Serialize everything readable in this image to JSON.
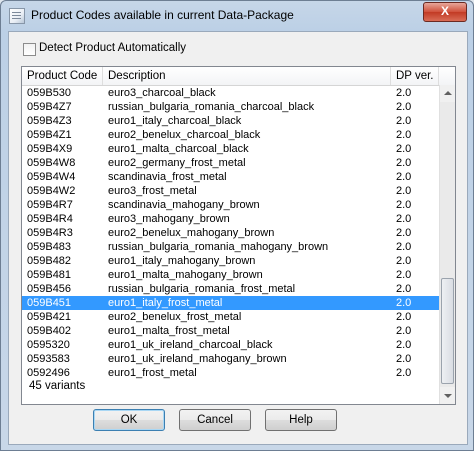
{
  "window": {
    "title": "Product Codes available in current Data-Package",
    "close_label": "X"
  },
  "detect": {
    "label": "Detect Product Automatically",
    "checked": false
  },
  "table": {
    "headers": {
      "code": "Product Code",
      "description": "Description",
      "version": "DP ver."
    },
    "rows": [
      {
        "code": "059B530",
        "description": "euro3_charcoal_black",
        "version": "2.0"
      },
      {
        "code": "059B4Z7",
        "description": "russian_bulgaria_romania_charcoal_black",
        "version": "2.0"
      },
      {
        "code": "059B4Z3",
        "description": "euro1_italy_charcoal_black",
        "version": "2.0"
      },
      {
        "code": "059B4Z1",
        "description": "euro2_benelux_charcoal_black",
        "version": "2.0"
      },
      {
        "code": "059B4X9",
        "description": "euro1_malta_charcoal_black",
        "version": "2.0"
      },
      {
        "code": "059B4W8",
        "description": "euro2_germany_frost_metal",
        "version": "2.0"
      },
      {
        "code": "059B4W4",
        "description": "scandinavia_frost_metal",
        "version": "2.0"
      },
      {
        "code": "059B4W2",
        "description": "euro3_frost_metal",
        "version": "2.0"
      },
      {
        "code": "059B4R7",
        "description": "scandinavia_mahogany_brown",
        "version": "2.0"
      },
      {
        "code": "059B4R4",
        "description": "euro3_mahogany_brown",
        "version": "2.0"
      },
      {
        "code": "059B4R3",
        "description": "euro2_benelux_mahogany_brown",
        "version": "2.0"
      },
      {
        "code": "059B483",
        "description": "russian_bulgaria_romania_mahogany_brown",
        "version": "2.0"
      },
      {
        "code": "059B482",
        "description": "euro1_italy_mahogany_brown",
        "version": "2.0"
      },
      {
        "code": "059B481",
        "description": "euro1_malta_mahogany_brown",
        "version": "2.0"
      },
      {
        "code": "059B456",
        "description": "russian_bulgaria_romania_frost_metal",
        "version": "2.0"
      },
      {
        "code": "059B451",
        "description": "euro1_italy_frost_metal",
        "version": "2.0",
        "selected": true
      },
      {
        "code": "059B421",
        "description": "euro2_benelux_frost_metal",
        "version": "2.0"
      },
      {
        "code": "059B402",
        "description": "euro1_malta_frost_metal",
        "version": "2.0"
      },
      {
        "code": "0595320",
        "description": "euro1_uk_ireland_charcoal_black",
        "version": "2.0"
      },
      {
        "code": "0593583",
        "description": "euro1_uk_ireland_mahogany_brown",
        "version": "2.0"
      },
      {
        "code": "0592496",
        "description": "euro1_frost_metal",
        "version": "2.0"
      }
    ]
  },
  "status": {
    "count_text": "45 variants"
  },
  "buttons": {
    "ok": "OK",
    "cancel": "Cancel",
    "help": "Help"
  },
  "colors": {
    "selection": "#3399ff",
    "frame": "#bcd0e6",
    "close": "#c23a24"
  }
}
